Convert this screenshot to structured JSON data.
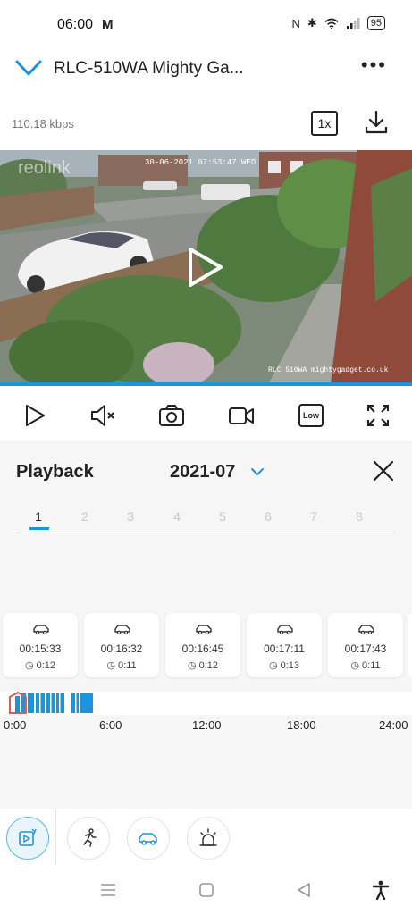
{
  "status_bar": {
    "time": "06:00",
    "battery": "95"
  },
  "header": {
    "title": "RLC-510WA Mighty Ga...",
    "bitrate": "110.18 kbps",
    "speed": "1x"
  },
  "video": {
    "overlay_timestamp": "30-06-2021 07:53:47 WED",
    "overlay_label": "RLC 510WA mightygadget.co.uk",
    "watermark": "reolink"
  },
  "controls": {
    "quality_label": "Low"
  },
  "playback": {
    "title": "Playback",
    "month": "2021-07",
    "days": [
      "1",
      "2",
      "3",
      "4",
      "5",
      "6",
      "7",
      "8"
    ],
    "selected_day": "1",
    "clips": [
      {
        "time": "00:15:33",
        "duration": "0:12"
      },
      {
        "time": "00:16:32",
        "duration": "0:11"
      },
      {
        "time": "00:16:45",
        "duration": "0:12"
      },
      {
        "time": "00:17:11",
        "duration": "0:13"
      },
      {
        "time": "00:17:43",
        "duration": "0:11"
      }
    ],
    "timeline_labels": [
      "0:00",
      "6:00",
      "12:00",
      "18:00",
      "24:00"
    ]
  },
  "colors": {
    "accent": "#1b95d9",
    "timeline_marker": "#e05a5a"
  }
}
